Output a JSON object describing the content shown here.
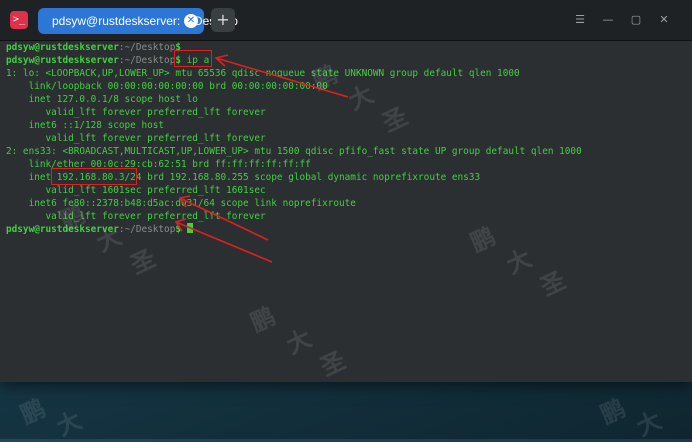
{
  "window": {
    "tab_title": "pdsyw@rustdeskserver: ~/Desktop",
    "app_icon_glyph": ">_",
    "tab_close_glyph": "✕",
    "new_tab_glyph": "+",
    "controls": {
      "menu": "☰",
      "minimize": "—",
      "maximize": "▢",
      "close": "✕"
    }
  },
  "terminal": {
    "user_host": "pdsyw@rustdeskserver",
    "path": ":~/Desktop",
    "prompt_suffix": "$",
    "command": " ip a",
    "output": [
      "1: lo: <LOOPBACK,UP,LOWER_UP> mtu 65536 qdisc noqueue state UNKNOWN group default qlen 1000",
      "    link/loopback 00:00:00:00:00:00 brd 00:00:00:00:00:00",
      "    inet 127.0.0.1/8 scope host lo",
      "       valid_lft forever preferred_lft forever",
      "    inet6 ::1/128 scope host",
      "       valid_lft forever preferred_lft forever",
      "2: ens33: <BROADCAST,MULTICAST,UP,LOWER_UP> mtu 1500 qdisc pfifo_fast state UP group default qlen 1000",
      "    link/ether 00:0c:29:cb:62:51 brd ff:ff:ff:ff:ff:ff",
      "    inet 192.168.80.3/24 brd 192.168.80.255 scope global dynamic noprefixroute ens33",
      "       valid_lft 1601sec preferred_lft 1601sec",
      "    inet6 fe80::2378:b48:d5ac:d031/64 scope link noprefixroute",
      "       valid_lft forever preferred_lft forever"
    ]
  },
  "watermark": [
    "鹏",
    "大",
    "圣"
  ],
  "colors": {
    "tab_active": "#2c76d6",
    "terminal_text": "#3fd13f",
    "annotation": "#e02020"
  }
}
